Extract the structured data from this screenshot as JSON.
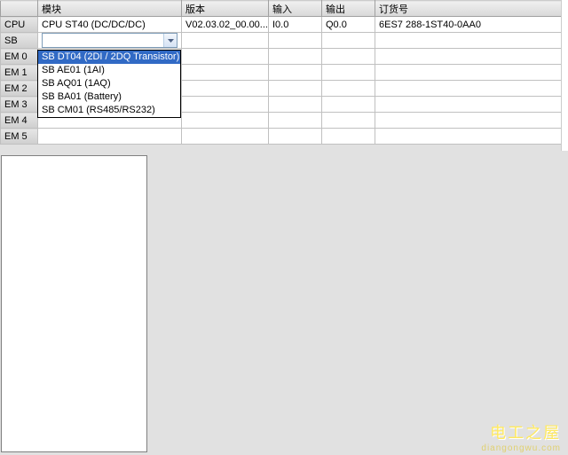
{
  "columns": {
    "module": "模块",
    "version": "版本",
    "input": "输入",
    "output": "输出",
    "order": "订货号"
  },
  "rows": [
    {
      "label": "CPU",
      "module": "CPU ST40 (DC/DC/DC)",
      "version": "V02.03.02_00.00...",
      "input": "I0.0",
      "output": "Q0.0",
      "order": "6ES7 288-1ST40-0AA0"
    },
    {
      "label": "SB",
      "module": "",
      "version": "",
      "input": "",
      "output": "",
      "order": "",
      "dropdown": true
    },
    {
      "label": "EM 0",
      "module": "",
      "version": "",
      "input": "",
      "output": "",
      "order": ""
    },
    {
      "label": "EM 1",
      "module": "",
      "version": "",
      "input": "",
      "output": "",
      "order": ""
    },
    {
      "label": "EM 2",
      "module": "",
      "version": "",
      "input": "",
      "output": "",
      "order": ""
    },
    {
      "label": "EM 3",
      "module": "",
      "version": "",
      "input": "",
      "output": "",
      "order": ""
    },
    {
      "label": "EM 4",
      "module": "",
      "version": "",
      "input": "",
      "output": "",
      "order": ""
    },
    {
      "label": "EM 5",
      "module": "",
      "version": "",
      "input": "",
      "output": "",
      "order": ""
    }
  ],
  "dropdown": {
    "options": [
      {
        "label": "SB DT04 (2DI / 2DQ Transistor)",
        "selected": true
      },
      {
        "label": "SB AE01 (1AI)",
        "selected": false
      },
      {
        "label": "SB AQ01 (1AQ)",
        "selected": false
      },
      {
        "label": "SB BA01 (Battery)",
        "selected": false
      },
      {
        "label": "SB CM01 (RS485/RS232)",
        "selected": false
      }
    ]
  },
  "watermark": {
    "title": "电工之屋",
    "url": "diangongwu.com"
  }
}
